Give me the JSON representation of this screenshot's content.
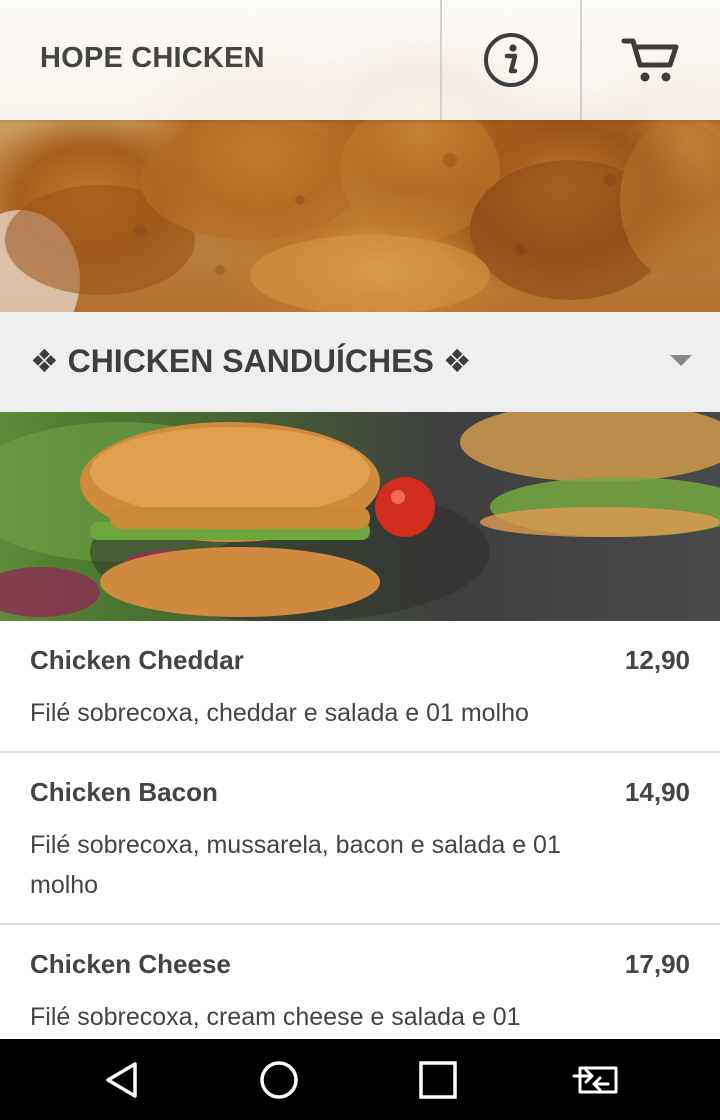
{
  "header": {
    "app_title": "HOPE CHICKEN",
    "info_icon": "info-icon",
    "cart_icon": "cart-icon"
  },
  "hero_image": "fried-chicken-photo",
  "category": {
    "label": "❖ CHICKEN SANDUÍCHES ❖",
    "expand_icon": "chevron-down-icon",
    "photo": "chicken-sandwich-photo"
  },
  "menu_items": [
    {
      "name": "Chicken Cheddar",
      "price": "12,90",
      "description": "Filé sobrecoxa, cheddar e salada e 01 molho"
    },
    {
      "name": "Chicken Bacon",
      "price": "14,90",
      "description": "Filé sobrecoxa, mussarela, bacon e salada e 01 molho"
    },
    {
      "name": "Chicken Cheese",
      "price": "17,90",
      "description": "Filé sobrecoxa, cream cheese e salada e 01"
    }
  ],
  "navbar": {
    "back_icon": "back-icon",
    "home_icon": "home-icon",
    "recents_icon": "recents-icon",
    "screen_switch_icon": "screen-switch-icon"
  },
  "colors": {
    "header_text": "#444444",
    "category_bg": "#efefef",
    "divider": "#dcdcdc",
    "navbar_bg": "#000000"
  }
}
